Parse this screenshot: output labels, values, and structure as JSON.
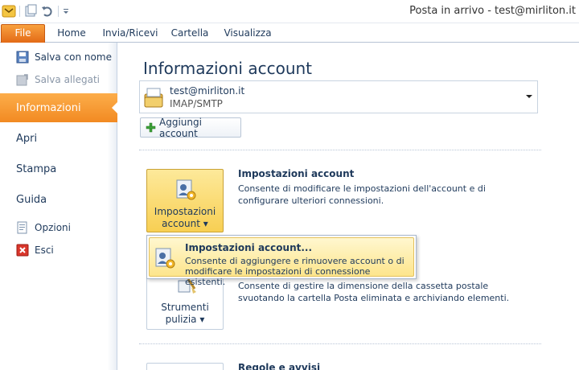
{
  "window": {
    "title": "Posta in arrivo - test@mirliton.it"
  },
  "tabs": [
    {
      "label": "File"
    },
    {
      "label": "Home"
    },
    {
      "label": "Invia/Ricevi"
    },
    {
      "label": "Cartella"
    },
    {
      "label": "Visualizza"
    }
  ],
  "backstage": {
    "save_as": "Salva con nome",
    "save_attachments": "Salva allegati",
    "info": "Informazioni",
    "open": "Apri",
    "print": "Stampa",
    "help": "Guida",
    "options": "Opzioni",
    "exit": "Esci"
  },
  "main": {
    "title": "Informazioni account",
    "account": {
      "name": "test@mirliton.it",
      "type": "IMAP/SMTP"
    },
    "add_account": "Aggiungi account",
    "account_settings": {
      "button_line1": "Impostazioni",
      "button_line2": "account",
      "title": "Impostazioni account",
      "desc": "Consente di modificare le impostazioni dell'account e di configurare ulteriori connessioni."
    },
    "cleanup": {
      "button_line1": "Strumenti",
      "button_line2": "pulizia",
      "desc": "Consente di gestire la dimensione della cassetta postale svuotando la cartella Posta eliminata e archiviando elementi."
    },
    "rules": {
      "title": "Regole e avvisi"
    }
  },
  "popup": {
    "title": "Impostazioni account...",
    "desc": "Consente di aggiungere e rimuovere account o di modificare le impostazioni di connessione esistenti."
  },
  "colors": {
    "accent_orange": "#f28a22",
    "highlight_yellow": "#f8cf53",
    "text_blue": "#1e395b"
  }
}
